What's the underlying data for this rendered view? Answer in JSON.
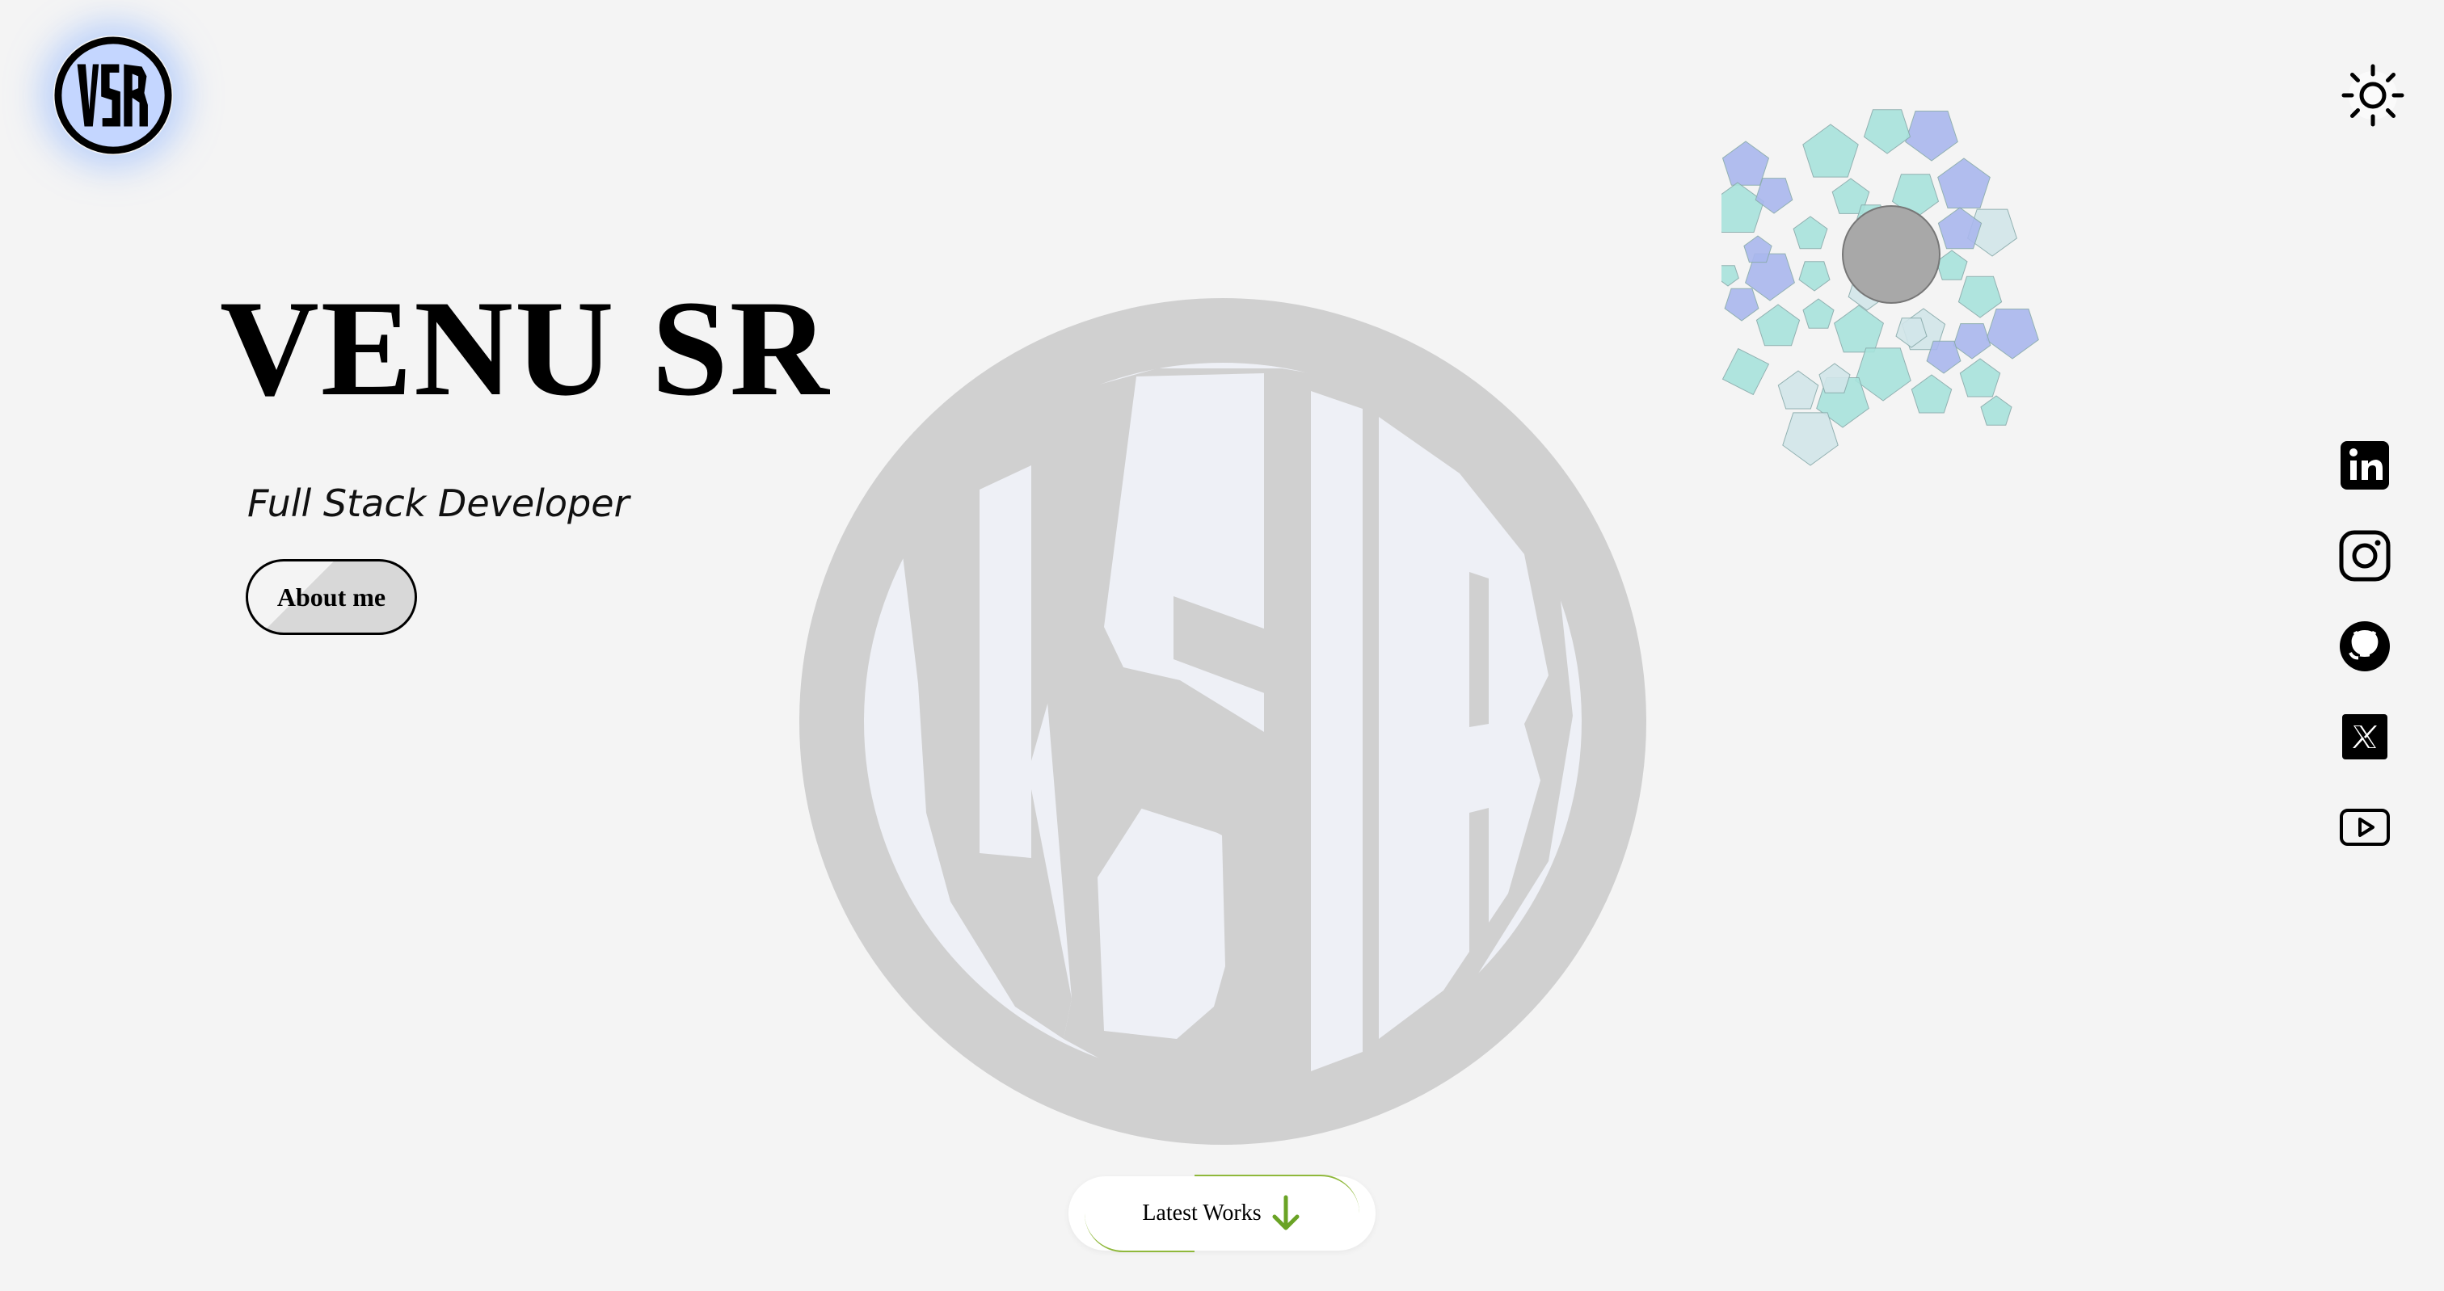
{
  "brand": {
    "logo_text": "VSR",
    "logo_color": "#c4d6ff",
    "glow_color": "#96b9ff"
  },
  "hero": {
    "name": "VENU SR",
    "role": "Full Stack Developer",
    "about_button": "About me"
  },
  "watermark": {
    "text": "VSR",
    "color": "#d0d0d0"
  },
  "theme_toggle": {
    "icon": "sun-icon"
  },
  "social_links": [
    {
      "name": "linkedin",
      "icon": "linkedin-icon"
    },
    {
      "name": "instagram",
      "icon": "instagram-icon"
    },
    {
      "name": "github",
      "icon": "github-icon"
    },
    {
      "name": "x",
      "icon": "x-icon"
    },
    {
      "name": "youtube",
      "icon": "youtube-icon"
    }
  ],
  "cta": {
    "latest_works": "Latest Works",
    "icon": "arrow-down-icon",
    "accent": "#6aa325"
  },
  "colors": {
    "background": "#f4f4f4",
    "teal": "#a8e3dc",
    "periwinkle": "#aab8ee",
    "pale": "#d2e6ea",
    "center": "#a8a8a8"
  }
}
